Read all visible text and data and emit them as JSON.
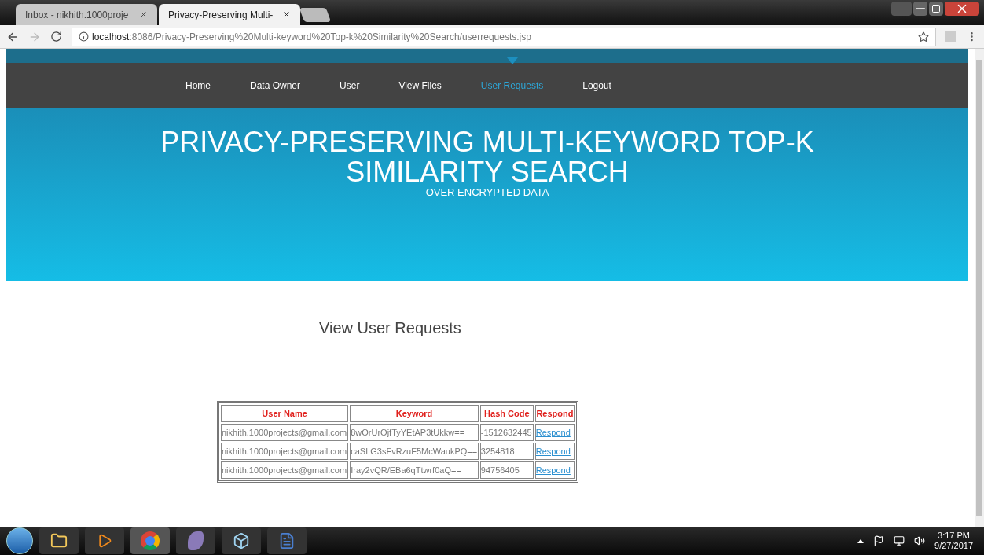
{
  "browser": {
    "tabs": [
      {
        "title": "Inbox - nikhith.1000proje",
        "selected": false
      },
      {
        "title": "Privacy-Preserving Multi-",
        "selected": true
      }
    ],
    "url_host": "localhost",
    "url_path": ":8086/Privacy-Preserving%20Multi-keyword%20Top-k%20Similarity%20Search/userrequests.jsp"
  },
  "nav": [
    {
      "label": "Home",
      "selected": false
    },
    {
      "label": "Data Owner",
      "selected": false
    },
    {
      "label": "User",
      "selected": false
    },
    {
      "label": "View Files",
      "selected": false
    },
    {
      "label": "User Requests",
      "selected": true
    },
    {
      "label": "Logout",
      "selected": false
    }
  ],
  "hero": {
    "title": "PRIVACY-PRESERVING MULTI-KEYWORD TOP-K SIMILARITY SEARCH",
    "subtitle": "OVER ENCRYPTED DATA"
  },
  "heading": "View User Requests",
  "table": {
    "columns": [
      "User Name",
      "Keyword",
      "Hash Code",
      "Respond"
    ],
    "rows": [
      [
        "nikhith.1000projects@gmail.com",
        "8wOrUrOjfTyYEtAP3tUkkw==",
        "-1512632445",
        "Respond"
      ],
      [
        "nikhith.1000projects@gmail.com",
        "caSLG3sFvRzuF5McWaukPQ==",
        "3254818",
        "Respond"
      ],
      [
        "nikhith.1000projects@gmail.com",
        "Iray2vQR/EBa6qTtwrf0aQ==",
        "94756405",
        "Respond"
      ]
    ]
  },
  "taskbar": {
    "time": "3:17 PM",
    "date": "9/27/2017"
  }
}
